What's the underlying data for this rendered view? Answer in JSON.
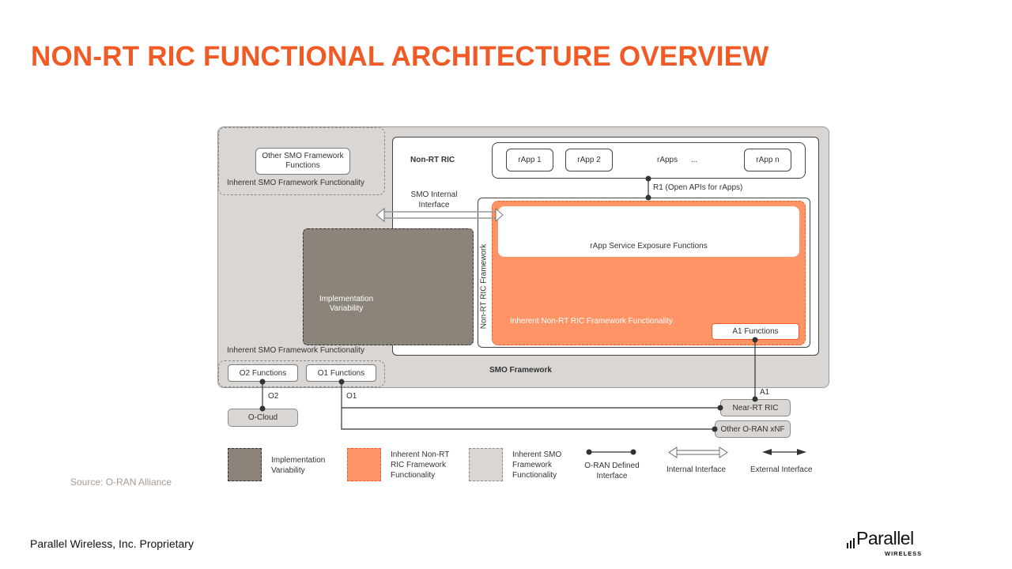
{
  "title": "NON-RT RIC FUNCTIONAL ARCHITECTURE OVERVIEW",
  "diagram": {
    "smo_framework_label": "SMO Framework",
    "other_smo_functions": "Other SMO Framework Functions",
    "inherent_smo_top": "Inherent SMO  Framework Functionality",
    "inherent_smo_bottom": "Inherent SMO  Framework Functionality",
    "non_rt_ric_label": "Non-RT RIC",
    "smo_internal_interface": "SMO Internal Interface",
    "rapps": [
      "rApp 1",
      "rApp 2",
      "rApp n"
    ],
    "rapps_label": "rApps",
    "rapps_ellipsis": "...",
    "r1_label": "R1  (Open APIs  for rApps)",
    "rapp_service_exposure": "rApp Service Exposure Functions",
    "non_rt_ric_framework_vertical": "Non-RT  RIC  Framework",
    "implementation_variability": "Implementation Variability",
    "inherent_non_rt_ric": "Inherent Non-RT  RIC  Framework Functionality",
    "a1_functions": "A1 Functions",
    "o2_functions": "O2 Functions",
    "o1_functions": "O1 Functions",
    "o2_label": "O2",
    "o1_label": "O1",
    "a1_label": "A1",
    "o_cloud": "O-Cloud",
    "near_rt_ric": "Near-RT RIC",
    "other_oran_xnf": "Other O-RAN xNF"
  },
  "legend": {
    "implementation_variability": "Implementation Variability",
    "inherent_non_rt_ric": "Inherent Non-RT RIC Framework Functionality",
    "inherent_smo": "Inherent SMO Framework Functionality",
    "oran_defined_interface": "O-RAN Defined Interface",
    "internal_interface": "Internal Interface",
    "external_interface": "External Interface"
  },
  "colors": {
    "accent": "#f15a24",
    "orange_fill": "#ff9466",
    "impl_variability": "#8c847b",
    "smo_gray": "#d9d6d3"
  },
  "source": "Source: O-RAN Alliance",
  "footer": "Parallel Wireless, Inc. Proprietary",
  "logo": {
    "name": "Parallel",
    "sub": "WIRELESS"
  }
}
